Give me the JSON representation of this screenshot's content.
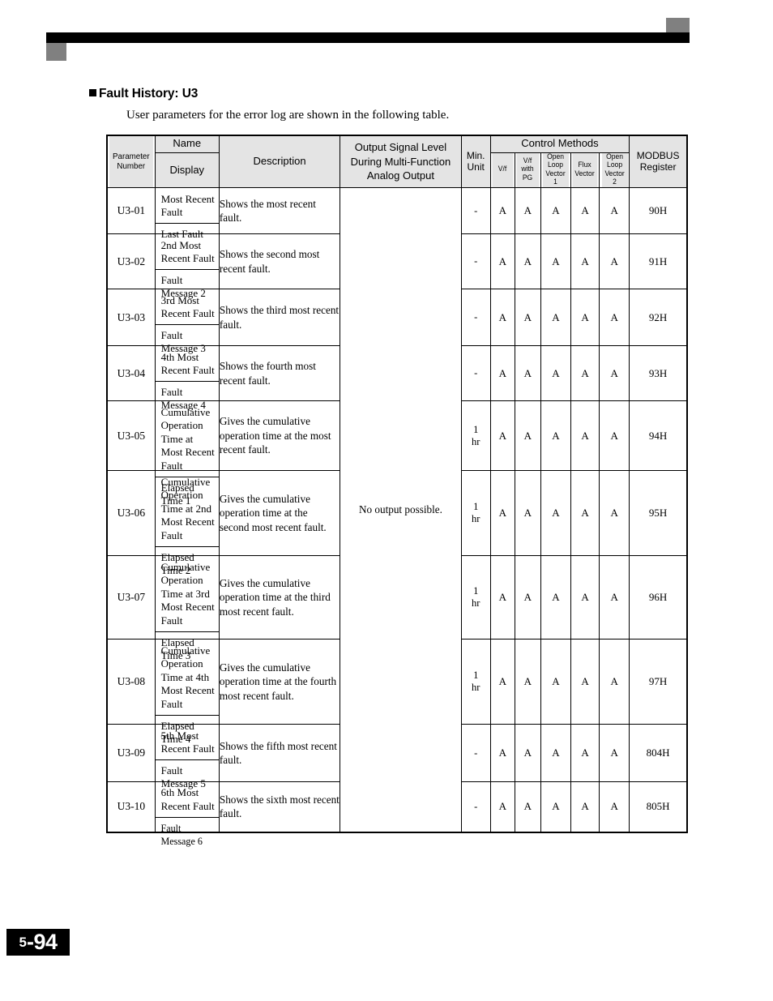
{
  "section": {
    "heading": "Fault History: U3",
    "intro": "User parameters for the error log are shown in the following table."
  },
  "table": {
    "headers": {
      "parameter_number": "Parameter\nNumber",
      "parameter_number_l1": "Parameter",
      "parameter_number_l2": "Number",
      "name": "Name",
      "display": "Display",
      "description": "Description",
      "output_signal_l1": "Output Signal Level",
      "output_signal_l2": "During Multi-Function",
      "output_signal_l3": "Analog Output",
      "min_unit_l1": "Min.",
      "min_unit_l2": "Unit",
      "control_methods": "Control Methods",
      "cm_vf": "V/f",
      "cm_vf_pg_l1": "V/f",
      "cm_vf_pg_l2": "with",
      "cm_vf_pg_l3": "PG",
      "cm_olv1_l1": "Open",
      "cm_olv1_l2": "Loop",
      "cm_olv1_l3": "Vector",
      "cm_olv1_l4": "1",
      "cm_flux_l1": "Flux",
      "cm_flux_l2": "Vector",
      "cm_olv2_l1": "Open",
      "cm_olv2_l2": "Loop",
      "cm_olv2_l3": "Vector",
      "cm_olv2_l4": "2",
      "modbus_l1": "MODBUS",
      "modbus_l2": "Register"
    },
    "output_signal_shared": "No output possible.",
    "rows": [
      {
        "param": "U3-01",
        "name": "Most Recent Fault",
        "display": "Last Fault",
        "description": "Shows the most recent fault.",
        "min_unit": "-",
        "min_unit_line2": "",
        "vf": "A",
        "vf_pg": "A",
        "olv1": "A",
        "flux": "A",
        "olv2": "A",
        "modbus": "90H"
      },
      {
        "param": "U3-02",
        "name": "2nd Most Recent Fault",
        "display": "Fault Message 2",
        "description": "Shows the second most recent fault.",
        "min_unit": "-",
        "min_unit_line2": "",
        "vf": "A",
        "vf_pg": "A",
        "olv1": "A",
        "flux": "A",
        "olv2": "A",
        "modbus": "91H"
      },
      {
        "param": "U3-03",
        "name": "3rd Most Recent Fault",
        "display": "Fault Message 3",
        "description": "Shows the third most recent fault.",
        "min_unit": "-",
        "min_unit_line2": "",
        "vf": "A",
        "vf_pg": "A",
        "olv1": "A",
        "flux": "A",
        "olv2": "A",
        "modbus": "92H"
      },
      {
        "param": "U3-04",
        "name": "4th Most Recent Fault",
        "display": "Fault Message 4",
        "description": "Shows the fourth most recent fault.",
        "min_unit": "-",
        "min_unit_line2": "",
        "vf": "A",
        "vf_pg": "A",
        "olv1": "A",
        "flux": "A",
        "olv2": "A",
        "modbus": "93H"
      },
      {
        "param": "U3-05",
        "name": "Cumulative Operation Time at Most Recent Fault",
        "display": "Elapsed Time 1",
        "description": "Gives the cumulative operation time at the most recent fault.",
        "min_unit": "1",
        "min_unit_line2": "hr",
        "vf": "A",
        "vf_pg": "A",
        "olv1": "A",
        "flux": "A",
        "olv2": "A",
        "modbus": "94H"
      },
      {
        "param": "U3-06",
        "name": "Cumulative Operation Time at 2nd Most Recent Fault",
        "display": "Elapsed Time 2",
        "description": "Gives the cumulative operation time at the second most recent fault.",
        "min_unit": "1",
        "min_unit_line2": "hr",
        "vf": "A",
        "vf_pg": "A",
        "olv1": "A",
        "flux": "A",
        "olv2": "A",
        "modbus": "95H"
      },
      {
        "param": "U3-07",
        "name": "Cumulative Operation Time at 3rd Most Recent Fault",
        "display": "Elapsed Time 3",
        "description": "Gives the cumulative operation time at the third most recent fault.",
        "min_unit": "1",
        "min_unit_line2": "hr",
        "vf": "A",
        "vf_pg": "A",
        "olv1": "A",
        "flux": "A",
        "olv2": "A",
        "modbus": "96H"
      },
      {
        "param": "U3-08",
        "name": "Cumulative Operation Time at 4th Most Recent Fault",
        "display": "Elapsed Time 4",
        "description": "Gives the cumulative operation time at the fourth most recent fault.",
        "min_unit": "1",
        "min_unit_line2": "hr",
        "vf": "A",
        "vf_pg": "A",
        "olv1": "A",
        "flux": "A",
        "olv2": "A",
        "modbus": "97H"
      },
      {
        "param": "U3-09",
        "name": "5th Most Recent Fault",
        "display": "Fault Message 5",
        "description": "Shows the fifth most recent fault.",
        "min_unit": "-",
        "min_unit_line2": "",
        "vf": "A",
        "vf_pg": "A",
        "olv1": "A",
        "flux": "A",
        "olv2": "A",
        "modbus": "804H"
      },
      {
        "param": "U3-10",
        "name": "6th Most Recent Fault",
        "display": "Fault Message 6",
        "description": "Shows the sixth most recent fault.",
        "min_unit": "-",
        "min_unit_line2": "",
        "vf": "A",
        "vf_pg": "A",
        "olv1": "A",
        "flux": "A",
        "olv2": "A",
        "modbus": "805H"
      }
    ]
  },
  "footer": {
    "page_section": "5",
    "page_separator": "-",
    "page_number": "94"
  }
}
